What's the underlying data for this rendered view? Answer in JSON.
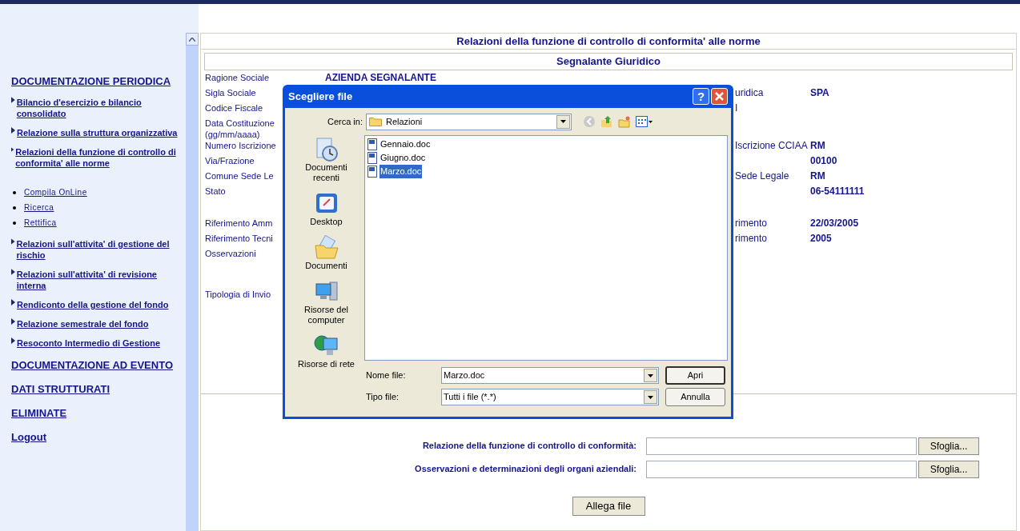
{
  "sidebar": {
    "items": [
      {
        "kind": "section",
        "label": "DOCUMENTAZIONE PERIODICA"
      },
      {
        "kind": "link",
        "label": "Bilancio d'esercizio e bilancio consolidato"
      },
      {
        "kind": "link",
        "label": "Relazione sulla struttura organizzativa"
      },
      {
        "kind": "link",
        "label": "Relazioni della funzione di controllo di conformita' alle norme",
        "children": [
          {
            "label": "Compila OnLine"
          },
          {
            "label": "Ricerca"
          },
          {
            "label": "Rettifica"
          }
        ]
      },
      {
        "kind": "link",
        "label": "Relazioni sull'attivita' di gestione del rischio"
      },
      {
        "kind": "link",
        "label": "Relazioni sull'attivita' di revisione interna"
      },
      {
        "kind": "link",
        "label": "Rendiconto della gestione del fondo"
      },
      {
        "kind": "link",
        "label": "Relazione semestrale del fondo"
      },
      {
        "kind": "link",
        "label": "Resoconto Intermedio di Gestione"
      },
      {
        "kind": "section",
        "label": "DOCUMENTAZIONE AD EVENTO"
      },
      {
        "kind": "section",
        "label": "DATI STRUTTURATI"
      },
      {
        "kind": "section",
        "label": "ELIMINATE"
      },
      {
        "kind": "section",
        "label": "Logout"
      }
    ]
  },
  "page_title": "Relazioni della funzione di controllo di conformita' alle norme",
  "section_title": "Segnalante Giuridico",
  "field_groups": [
    [
      {
        "label": "Ragione Sociale",
        "middle_value": "AZIENDA SEGNALANTE"
      },
      {
        "label": "Sigla Sociale",
        "right_label": "uridica",
        "value": "SPA"
      },
      {
        "label": "Codice Fiscale",
        "right_label": "I"
      },
      {
        "label": "Data Costituzione (gg/mm/aaaa)"
      },
      {
        "label": "Numero Iscrizione",
        "right_label": "Iscrizione CCIAA",
        "value": "RM"
      },
      {
        "label": "Via/Frazione",
        "value": "00100"
      },
      {
        "label": "Comune Sede Le",
        "right_label": "Sede Legale",
        "value": "RM"
      },
      {
        "label": "Stato",
        "value": "06-54111111"
      }
    ],
    [
      {
        "label": "Riferimento Amm",
        "right_label": "rimento",
        "value": "22/03/2005"
      },
      {
        "label": "Riferimento Tecni",
        "right_label": "rimento",
        "value": "2005"
      },
      {
        "label": "Osservazioni"
      }
    ],
    [
      {
        "label": "Tipologia di Invio"
      }
    ]
  ],
  "uploads": [
    {
      "label": "Relazione della funzione di controllo di conformità:",
      "button": "Sfoglia..."
    },
    {
      "label": "Osservazioni e determinazioni degli organi aziendali:",
      "button": "Sfoglia..."
    }
  ],
  "attach_button": "Allega file",
  "dialog": {
    "title": "Scegliere file",
    "help": "?",
    "look_in_label": "Cerca in:",
    "look_in": "Relazioni",
    "places": [
      {
        "kind": "recent",
        "label": "Documenti recenti"
      },
      {
        "kind": "desktop",
        "label": "Desktop"
      },
      {
        "kind": "documents",
        "label": "Documenti"
      },
      {
        "kind": "computer",
        "label": "Risorse del computer"
      },
      {
        "kind": "network",
        "label": "Risorse di rete"
      }
    ],
    "files": [
      {
        "name": "Gennaio.doc",
        "selected": false
      },
      {
        "name": "Giugno.doc",
        "selected": false
      },
      {
        "name": "Marzo.doc",
        "selected": true
      }
    ],
    "filename_label": "Nome file:",
    "filename": "Marzo.doc",
    "filetype_label": "Tipo file:",
    "filetype": "Tutti i file (*.*)",
    "open_button": "Apri",
    "cancel_button": "Annulla"
  }
}
